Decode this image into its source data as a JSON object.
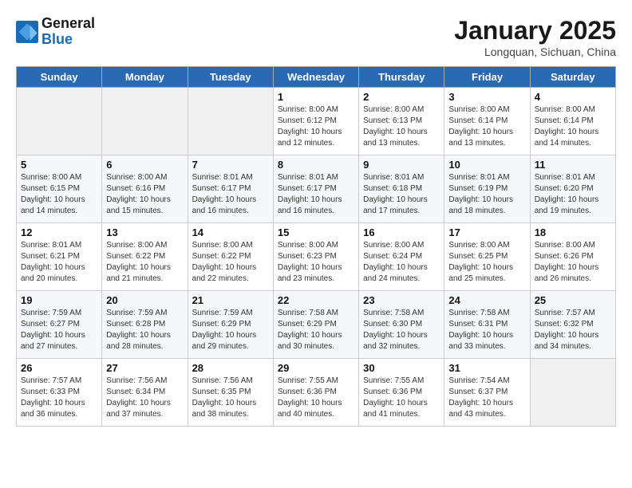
{
  "header": {
    "logo_line1": "General",
    "logo_line2": "Blue",
    "month": "January 2025",
    "location": "Longquan, Sichuan, China"
  },
  "weekdays": [
    "Sunday",
    "Monday",
    "Tuesday",
    "Wednesday",
    "Thursday",
    "Friday",
    "Saturday"
  ],
  "weeks": [
    [
      {
        "day": "",
        "info": ""
      },
      {
        "day": "",
        "info": ""
      },
      {
        "day": "",
        "info": ""
      },
      {
        "day": "1",
        "info": "Sunrise: 8:00 AM\nSunset: 6:12 PM\nDaylight: 10 hours\nand 12 minutes."
      },
      {
        "day": "2",
        "info": "Sunrise: 8:00 AM\nSunset: 6:13 PM\nDaylight: 10 hours\nand 13 minutes."
      },
      {
        "day": "3",
        "info": "Sunrise: 8:00 AM\nSunset: 6:14 PM\nDaylight: 10 hours\nand 13 minutes."
      },
      {
        "day": "4",
        "info": "Sunrise: 8:00 AM\nSunset: 6:14 PM\nDaylight: 10 hours\nand 14 minutes."
      }
    ],
    [
      {
        "day": "5",
        "info": "Sunrise: 8:00 AM\nSunset: 6:15 PM\nDaylight: 10 hours\nand 14 minutes."
      },
      {
        "day": "6",
        "info": "Sunrise: 8:00 AM\nSunset: 6:16 PM\nDaylight: 10 hours\nand 15 minutes."
      },
      {
        "day": "7",
        "info": "Sunrise: 8:01 AM\nSunset: 6:17 PM\nDaylight: 10 hours\nand 16 minutes."
      },
      {
        "day": "8",
        "info": "Sunrise: 8:01 AM\nSunset: 6:17 PM\nDaylight: 10 hours\nand 16 minutes."
      },
      {
        "day": "9",
        "info": "Sunrise: 8:01 AM\nSunset: 6:18 PM\nDaylight: 10 hours\nand 17 minutes."
      },
      {
        "day": "10",
        "info": "Sunrise: 8:01 AM\nSunset: 6:19 PM\nDaylight: 10 hours\nand 18 minutes."
      },
      {
        "day": "11",
        "info": "Sunrise: 8:01 AM\nSunset: 6:20 PM\nDaylight: 10 hours\nand 19 minutes."
      }
    ],
    [
      {
        "day": "12",
        "info": "Sunrise: 8:01 AM\nSunset: 6:21 PM\nDaylight: 10 hours\nand 20 minutes."
      },
      {
        "day": "13",
        "info": "Sunrise: 8:00 AM\nSunset: 6:22 PM\nDaylight: 10 hours\nand 21 minutes."
      },
      {
        "day": "14",
        "info": "Sunrise: 8:00 AM\nSunset: 6:22 PM\nDaylight: 10 hours\nand 22 minutes."
      },
      {
        "day": "15",
        "info": "Sunrise: 8:00 AM\nSunset: 6:23 PM\nDaylight: 10 hours\nand 23 minutes."
      },
      {
        "day": "16",
        "info": "Sunrise: 8:00 AM\nSunset: 6:24 PM\nDaylight: 10 hours\nand 24 minutes."
      },
      {
        "day": "17",
        "info": "Sunrise: 8:00 AM\nSunset: 6:25 PM\nDaylight: 10 hours\nand 25 minutes."
      },
      {
        "day": "18",
        "info": "Sunrise: 8:00 AM\nSunset: 6:26 PM\nDaylight: 10 hours\nand 26 minutes."
      }
    ],
    [
      {
        "day": "19",
        "info": "Sunrise: 7:59 AM\nSunset: 6:27 PM\nDaylight: 10 hours\nand 27 minutes."
      },
      {
        "day": "20",
        "info": "Sunrise: 7:59 AM\nSunset: 6:28 PM\nDaylight: 10 hours\nand 28 minutes."
      },
      {
        "day": "21",
        "info": "Sunrise: 7:59 AM\nSunset: 6:29 PM\nDaylight: 10 hours\nand 29 minutes."
      },
      {
        "day": "22",
        "info": "Sunrise: 7:58 AM\nSunset: 6:29 PM\nDaylight: 10 hours\nand 30 minutes."
      },
      {
        "day": "23",
        "info": "Sunrise: 7:58 AM\nSunset: 6:30 PM\nDaylight: 10 hours\nand 32 minutes."
      },
      {
        "day": "24",
        "info": "Sunrise: 7:58 AM\nSunset: 6:31 PM\nDaylight: 10 hours\nand 33 minutes."
      },
      {
        "day": "25",
        "info": "Sunrise: 7:57 AM\nSunset: 6:32 PM\nDaylight: 10 hours\nand 34 minutes."
      }
    ],
    [
      {
        "day": "26",
        "info": "Sunrise: 7:57 AM\nSunset: 6:33 PM\nDaylight: 10 hours\nand 36 minutes."
      },
      {
        "day": "27",
        "info": "Sunrise: 7:56 AM\nSunset: 6:34 PM\nDaylight: 10 hours\nand 37 minutes."
      },
      {
        "day": "28",
        "info": "Sunrise: 7:56 AM\nSunset: 6:35 PM\nDaylight: 10 hours\nand 38 minutes."
      },
      {
        "day": "29",
        "info": "Sunrise: 7:55 AM\nSunset: 6:36 PM\nDaylight: 10 hours\nand 40 minutes."
      },
      {
        "day": "30",
        "info": "Sunrise: 7:55 AM\nSunset: 6:36 PM\nDaylight: 10 hours\nand 41 minutes."
      },
      {
        "day": "31",
        "info": "Sunrise: 7:54 AM\nSunset: 6:37 PM\nDaylight: 10 hours\nand 43 minutes."
      },
      {
        "day": "",
        "info": ""
      }
    ]
  ]
}
